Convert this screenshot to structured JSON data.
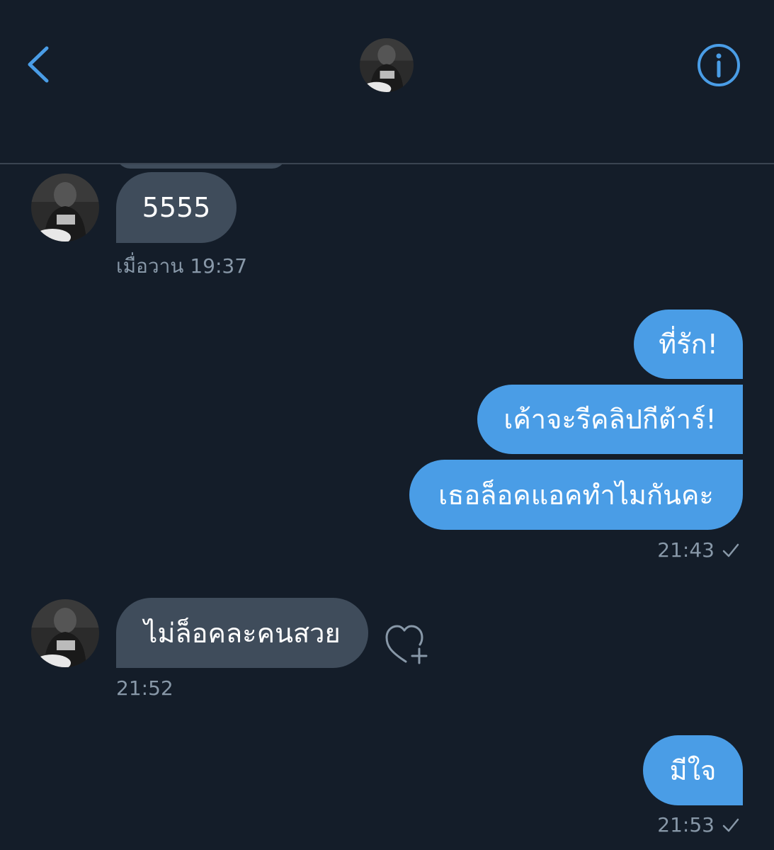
{
  "header": {
    "back_icon": "chevron-left-icon",
    "info_icon": "info-circle-icon",
    "accent_color": "#4a9de6"
  },
  "messages": [
    {
      "id": "m1",
      "direction": "incoming",
      "text": "5555"
    },
    {
      "id": "m1_time",
      "timestamp": "เมื่อวาน 19:37"
    },
    {
      "id": "m2",
      "direction": "outgoing",
      "text": "ที่รัก!"
    },
    {
      "id": "m3",
      "direction": "outgoing",
      "text": "เค้าจะรีคลิปกีต้าร์!"
    },
    {
      "id": "m4",
      "direction": "outgoing",
      "text": "เธอล็อคแอคทำไมกันคะ"
    },
    {
      "id": "m4_time",
      "timestamp": "21:43"
    },
    {
      "id": "m5",
      "direction": "incoming",
      "text": "ไม่ล็อคละคนสวย"
    },
    {
      "id": "m5_time",
      "timestamp": "21:52"
    },
    {
      "id": "m6",
      "direction": "outgoing",
      "text": "มีใจ"
    },
    {
      "id": "m6_time",
      "timestamp": "21:53"
    }
  ],
  "thread": {
    "incoming_1": "5555",
    "incoming_1_time": "เมื่อวาน 19:37",
    "outgoing_group_1": [
      "ที่รัก!",
      "เค้าจะรีคลิปกีต้าร์!",
      "เธอล็อคแอคทำไมกันคะ"
    ],
    "outgoing_group_1_time": "21:43",
    "incoming_2": "ไม่ล็อคละคนสวย",
    "incoming_2_time": "21:52",
    "outgoing_2": "มีใจ",
    "outgoing_2_time": "21:53"
  },
  "icons": {
    "read_receipt": "checkmark-icon",
    "reaction": "heart-plus-icon"
  },
  "colors": {
    "background": "#141d29",
    "incoming_bubble": "#3f4c5b",
    "outgoing_bubble": "#4a9de6",
    "timestamp": "#8898a8"
  }
}
